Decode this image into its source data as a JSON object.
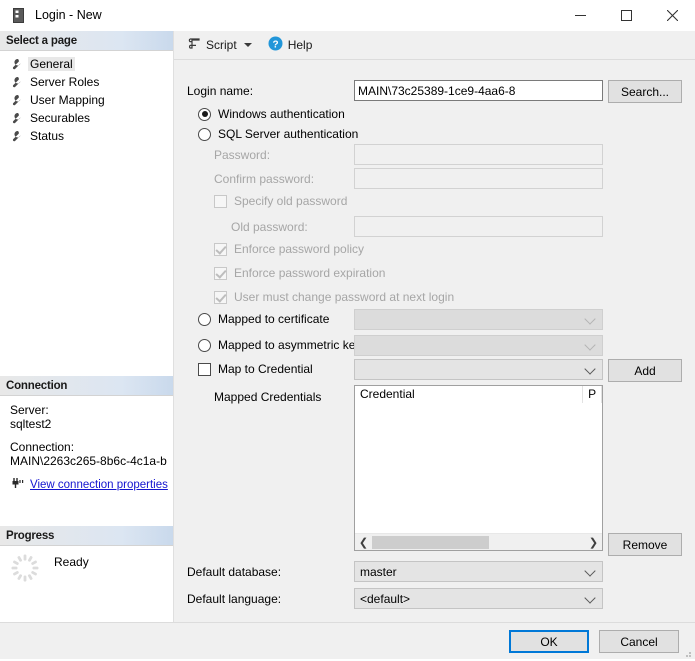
{
  "window": {
    "title": "Login - New",
    "icon": "server-icon",
    "minimize": "—",
    "maximize": "□",
    "close": "✕"
  },
  "sidebar": {
    "header": "Select a page",
    "items": [
      {
        "label": "General",
        "icon": "wrench-icon",
        "selected": true
      },
      {
        "label": "Server Roles",
        "icon": "wrench-icon",
        "selected": false
      },
      {
        "label": "User Mapping",
        "icon": "wrench-icon",
        "selected": false
      },
      {
        "label": "Securables",
        "icon": "wrench-icon",
        "selected": false
      },
      {
        "label": "Status",
        "icon": "wrench-icon",
        "selected": false
      }
    ],
    "connection": {
      "header": "Connection",
      "server_label": "Server:",
      "server_value": "sqltest2",
      "connection_label": "Connection:",
      "connection_value": "MAIN\\2263c265-8b6c-4c1a-b",
      "link": "View connection properties",
      "link_icon": "plug-icon",
      "link_color": "#1414cf"
    },
    "progress": {
      "header": "Progress",
      "status": "Ready",
      "icon": "spinner-icon"
    }
  },
  "toolbar": {
    "script_label": "Script",
    "script_icon": "script-icon",
    "script_caret": "chevron-down-icon",
    "help_label": "Help",
    "help_icon": "help-circle-icon",
    "help_icon_color": "#2196d9"
  },
  "form": {
    "login_name_label": "Login name:",
    "login_name_value": "MAIN\\73c25389-1ce9-4aa6-8",
    "search_button": "Search...",
    "windows_auth": "Windows authentication",
    "sql_auth": "SQL Server authentication",
    "password_label": "Password:",
    "password_value": "",
    "confirm_password_label": "Confirm password:",
    "confirm_password_value": "",
    "specify_old_password": "Specify old password",
    "old_password_label": "Old password:",
    "old_password_value": "",
    "enforce_password_policy": "Enforce password policy",
    "enforce_password_expiration": "Enforce password expiration",
    "user_must_change": "User must change password at next login",
    "mapped_to_certificate": "Mapped to certificate",
    "certificate_value": "",
    "mapped_to_asymmetric_key": "Mapped to asymmetric key",
    "asymmetric_key_value": "",
    "map_to_credential": "Map to Credential",
    "credential_value": "",
    "add_button": "Add",
    "mapped_credentials_label": "Mapped Credentials",
    "credentials_columns": [
      "Credential",
      "P"
    ],
    "credentials_rows": [],
    "remove_button": "Remove",
    "default_database_label": "Default database:",
    "default_database_value": "master",
    "default_language_label": "Default language:",
    "default_language_value": "<default>"
  },
  "footer": {
    "ok_label": "OK",
    "cancel_label": "Cancel"
  }
}
